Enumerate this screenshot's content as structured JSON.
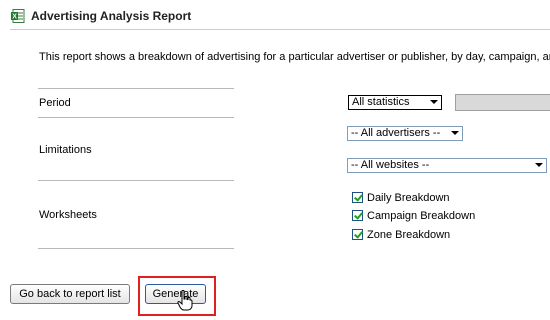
{
  "header": {
    "title": "Advertising Analysis Report",
    "icon": "spreadsheet-icon"
  },
  "description": "This report shows a breakdown of advertising for a particular advertiser or publisher, by day, campaign, and zone.",
  "form": {
    "period": {
      "label": "Period",
      "select_value": "All statistics"
    },
    "limitations": {
      "label": "Limitations",
      "advertisers_value": "-- All advertisers --",
      "websites_value": "-- All websites --"
    },
    "worksheets": {
      "label": "Worksheets",
      "options": [
        {
          "label": "Daily Breakdown",
          "checked": true
        },
        {
          "label": "Campaign Breakdown",
          "checked": true
        },
        {
          "label": "Zone Breakdown",
          "checked": true
        }
      ]
    }
  },
  "buttons": {
    "back_label": "Go back to report list",
    "generate_label": "Generate"
  },
  "colors": {
    "highlight": "#e02020",
    "check": "#21a121"
  }
}
